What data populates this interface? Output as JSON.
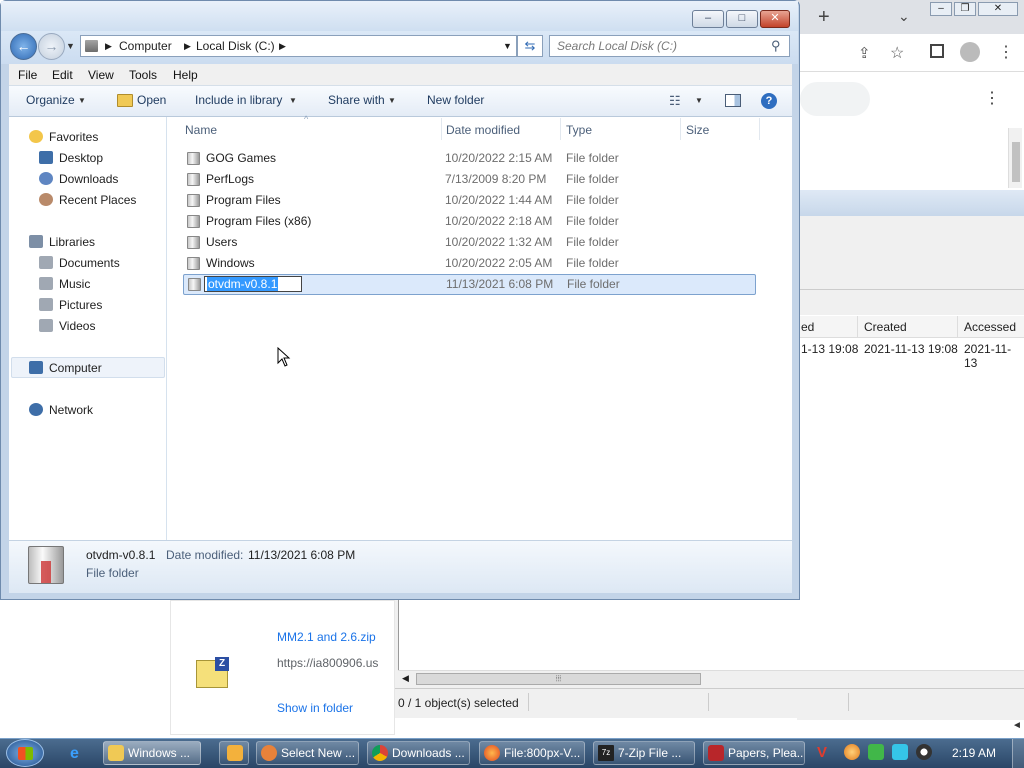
{
  "explorer": {
    "breadcrumb": [
      "Computer",
      "Local Disk (C:)"
    ],
    "search_placeholder": "Search Local Disk (C:)",
    "menu": [
      "File",
      "Edit",
      "View",
      "Tools",
      "Help"
    ],
    "commands": [
      "Organize",
      "Open",
      "Include in library",
      "Share with",
      "New folder"
    ],
    "nav": {
      "favorites_label": "Favorites",
      "favorites": [
        "Desktop",
        "Downloads",
        "Recent Places"
      ],
      "libraries_label": "Libraries",
      "libraries": [
        "Documents",
        "Music",
        "Pictures",
        "Videos"
      ],
      "computer": "Computer",
      "network": "Network"
    },
    "columns": [
      "Name",
      "Date modified",
      "Type",
      "Size"
    ],
    "files": [
      {
        "name": "GOG Games",
        "date": "10/20/2022 2:15 AM",
        "type": "File folder"
      },
      {
        "name": "PerfLogs",
        "date": "7/13/2009 8:20 PM",
        "type": "File folder"
      },
      {
        "name": "Program Files",
        "date": "10/20/2022 1:44 AM",
        "type": "File folder"
      },
      {
        "name": "Program Files (x86)",
        "date": "10/20/2022 2:18 AM",
        "type": "File folder"
      },
      {
        "name": "Users",
        "date": "10/20/2022 1:32 AM",
        "type": "File folder"
      },
      {
        "name": "Windows",
        "date": "10/20/2022 2:05 AM",
        "type": "File folder"
      },
      {
        "name": "otvdm-v0.8.1",
        "date": "11/13/2021 6:08 PM",
        "type": "File folder"
      }
    ],
    "details": {
      "name": "otvdm-v0.8.1",
      "date_label": "Date modified:",
      "date": "11/13/2021 6:08 PM",
      "type": "File folder"
    }
  },
  "zip": {
    "columns": [
      "ed",
      "Created",
      "Accessed"
    ],
    "row": [
      "1-13 19:08",
      "2021-11-13 19:08",
      "2021-11-13"
    ],
    "status": "0 / 1 object(s) selected"
  },
  "downloads": {
    "file_name": "MM2.1 and 2.6.zip",
    "url": "https://ia800906.us",
    "show_in_folder": "Show in folder"
  },
  "taskbar": {
    "items": [
      "Windows ...",
      "Select New ...",
      "Downloads ...",
      "File:800px-V...",
      "7-Zip File ...",
      "Papers, Plea..."
    ],
    "clock": "2:19 AM"
  }
}
